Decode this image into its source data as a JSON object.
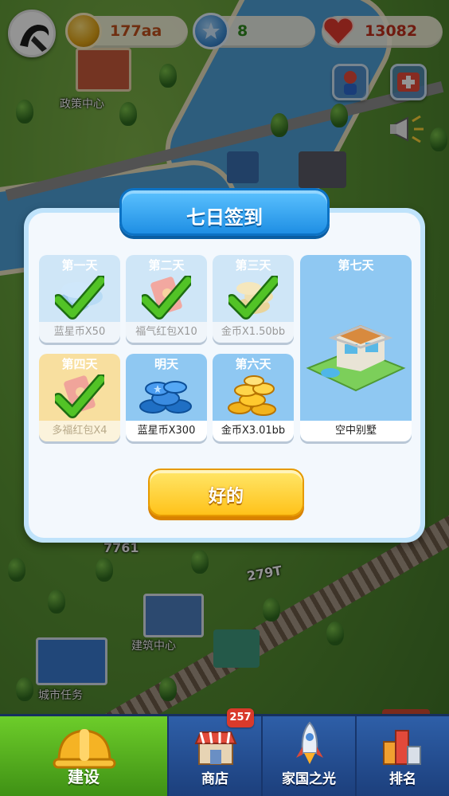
{
  "hud": {
    "coins": "177aa",
    "stars": "8",
    "hearts": "13082"
  },
  "map": {
    "labels": [
      "政策中心",
      "建筑中心",
      "城市任务"
    ],
    "signs": [
      "7761",
      "279T"
    ]
  },
  "dialog": {
    "title": "七日签到",
    "days": [
      {
        "day": "第一天",
        "reward": "蓝星币X50",
        "state": "claimed"
      },
      {
        "day": "第二天",
        "reward": "福气红包X10",
        "state": "claimed"
      },
      {
        "day": "第三天",
        "reward": "金币X1.50bb",
        "state": "claimed"
      },
      {
        "day": "第四天",
        "reward": "多福红包X4",
        "state": "claimed"
      },
      {
        "day": "明天",
        "reward": "蓝星币X300",
        "state": "upcoming"
      },
      {
        "day": "第六天",
        "reward": "金币X3.01bb",
        "state": "upcoming"
      },
      {
        "day": "第七天",
        "reward": "空中别墅",
        "state": "upcoming"
      }
    ],
    "ok_label": "好的"
  },
  "nav": {
    "items": [
      {
        "label": "建设",
        "active": true
      },
      {
        "label": "商店",
        "active": false
      },
      {
        "label": "家国之光",
        "active": false
      },
      {
        "label": "排名",
        "active": false
      }
    ],
    "shop_badge": "257"
  },
  "colors": {
    "accent_blue": "#1f8fe4",
    "ok_yellow": "#ffc21a",
    "nav_active_green": "#4ea81c",
    "check_green": "#3fae1e",
    "heart_red": "#e23a2e"
  }
}
